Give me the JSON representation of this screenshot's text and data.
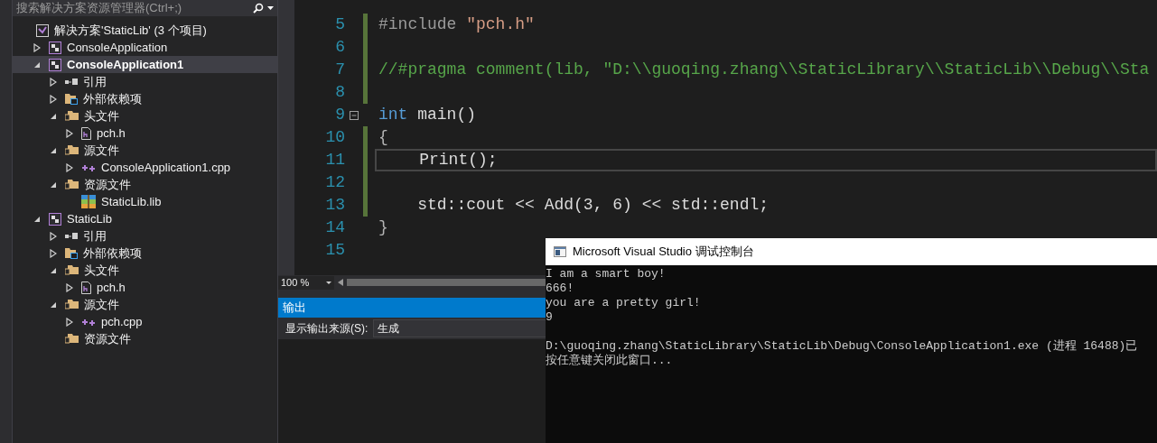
{
  "search": {
    "placeholder": "搜索解决方案资源管理器(Ctrl+;)"
  },
  "solution": {
    "label": "解决方案'StaticLib' (3 个项目)"
  },
  "tree": [
    {
      "kind": "project",
      "label": "ConsoleApplication",
      "expanded": false,
      "selected": false
    },
    {
      "kind": "project",
      "label": "ConsoleApplication1",
      "expanded": true,
      "selected": true,
      "children": [
        {
          "kind": "references",
          "label": "引用",
          "expanded": false,
          "selected": false
        },
        {
          "kind": "external",
          "label": "外部依赖项",
          "expanded": false,
          "selected": false
        },
        {
          "kind": "filter",
          "label": "头文件",
          "expanded": true,
          "selected": false,
          "children": [
            {
              "kind": "header",
              "label": "pch.h",
              "expanded": false,
              "selected": false
            }
          ]
        },
        {
          "kind": "filter",
          "label": "源文件",
          "expanded": true,
          "selected": false,
          "children": [
            {
              "kind": "source",
              "label": "ConsoleApplication1.cpp",
              "expanded": false,
              "selected": false
            }
          ]
        },
        {
          "kind": "filter",
          "label": "资源文件",
          "expanded": true,
          "selected": false,
          "children": [
            {
              "kind": "lib",
              "label": "StaticLib.lib",
              "selected": false
            }
          ]
        }
      ]
    },
    {
      "kind": "project",
      "label": "StaticLib",
      "expanded": true,
      "selected": false,
      "children": [
        {
          "kind": "references",
          "label": "引用",
          "expanded": false,
          "selected": false
        },
        {
          "kind": "external",
          "label": "外部依赖项",
          "expanded": false,
          "selected": false
        },
        {
          "kind": "filter",
          "label": "头文件",
          "expanded": true,
          "selected": false,
          "children": [
            {
              "kind": "header",
              "label": "pch.h",
              "expanded": false,
              "selected": false
            }
          ]
        },
        {
          "kind": "filter",
          "label": "源文件",
          "expanded": true,
          "selected": false,
          "children": [
            {
              "kind": "source",
              "label": "pch.cpp",
              "expanded": false,
              "selected": false
            }
          ]
        },
        {
          "kind": "filter",
          "label": "资源文件",
          "selected": false
        }
      ]
    }
  ],
  "editor": {
    "lines": [
      {
        "number": "5",
        "changed": true,
        "current": false,
        "fold": false,
        "tokens": [
          {
            "kind": "preprocessor",
            "text": "#include "
          },
          {
            "kind": "string",
            "text": "\"pch.h\""
          }
        ]
      },
      {
        "number": "6",
        "changed": true,
        "current": false,
        "fold": false
      },
      {
        "number": "7",
        "changed": true,
        "current": false,
        "fold": false,
        "tokens": [
          {
            "kind": "comment",
            "text": "//#pragma comment(lib, \"D:\\\\guoqing.zhang\\\\StaticLibrary\\\\StaticLib\\\\Debug\\\\Sta"
          }
        ]
      },
      {
        "number": "8",
        "changed": true,
        "current": false,
        "fold": false
      },
      {
        "number": "9",
        "changed": false,
        "current": false,
        "fold": true,
        "tokens": [
          {
            "kind": "keyword",
            "text": "int"
          },
          {
            "kind": "plain",
            "text": " main()"
          }
        ]
      },
      {
        "number": "10",
        "changed": true,
        "current": false,
        "fold": false,
        "tokens": [
          {
            "kind": "brace",
            "text": "{"
          }
        ]
      },
      {
        "number": "11",
        "changed": true,
        "current": true,
        "fold": false,
        "tokens": [
          {
            "kind": "plain",
            "text": "    Print();"
          }
        ]
      },
      {
        "number": "12",
        "changed": true,
        "current": false,
        "fold": false
      },
      {
        "number": "13",
        "changed": true,
        "current": false,
        "fold": false,
        "tokens": [
          {
            "kind": "plain",
            "text": "    std::cout << Add(3, 6) << std::endl;"
          }
        ]
      },
      {
        "number": "14",
        "changed": false,
        "current": false,
        "fold": false,
        "tokens": [
          {
            "kind": "brace",
            "text": "}"
          }
        ]
      },
      {
        "number": "15",
        "changed": false,
        "current": false,
        "fold": false
      }
    ],
    "zoom": "100 %"
  },
  "output": {
    "title": "输出",
    "source_label": "显示输出来源(S):",
    "source_value": "生成"
  },
  "console": {
    "title": "Microsoft Visual Studio 调试控制台",
    "blocks": [
      [
        "I am a smart boy!",
        "666!",
        "you are a pretty girl!",
        "9"
      ],
      [
        "D:\\guoqing.zhang\\StaticLibrary\\StaticLib\\Debug\\ConsoleApplication1.exe (进程 16488)已",
        "按任意键关闭此窗口..."
      ]
    ]
  }
}
